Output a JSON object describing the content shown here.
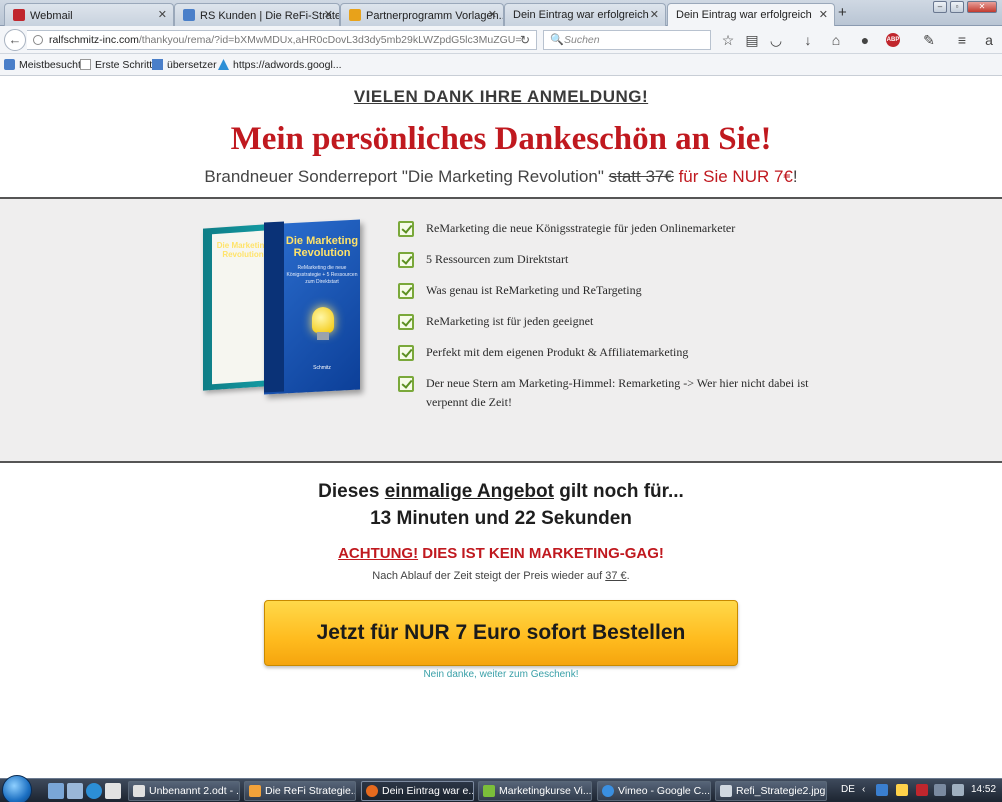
{
  "browser": {
    "tabs": [
      {
        "label": "Webmail",
        "color": "#c0262d"
      },
      {
        "label": "RS Kunden | Die ReFi-Strategie",
        "color": "#4a7fc9"
      },
      {
        "label": "Partnerprogramm Vorlagen...",
        "color": "#e8a21a"
      },
      {
        "label": "Dein Eintrag war erfolgreich",
        "color": "#4a7fc9"
      },
      {
        "label": "Dein Eintrag war erfolgreich",
        "color": "#4a7fc9"
      }
    ],
    "newtab": "+",
    "url_host": "ralfschmitz-inc.com",
    "url_path": "/thankyou/rema/?id=bXMwMDUx,aHR0cDovL3d3dy5mb29kLWZpdG5lc3MuZGU=",
    "search_placeholder": "Suchen",
    "abp_label": "ABP",
    "bookmarks": [
      {
        "label": "Meistbesucht",
        "color": "#4a7fc9"
      },
      {
        "label": "Erste Schritte",
        "color": "#ffffff"
      },
      {
        "label": "übersetzer",
        "color": "#4a7fc9"
      },
      {
        "label": "https://adwords.googl...",
        "color": "#2c8fd6"
      }
    ]
  },
  "page": {
    "vielen_dank": "VIELEN DANK IHRE ANMELDUNG!",
    "title": "Mein persönliches Dankeschön an Sie!",
    "subline_pre": "Brandneuer Sonderreport \"Die Marketing Revolution\"",
    "subline_strike": "statt 37€",
    "subline_red": "für Sie NUR 7€",
    "subline_end": "!",
    "book": {
      "title": "Die Marketing Revolution",
      "subtitle": "ReMarketing die neue Königsstrategie + 5 Ressourcen zum Direktstart",
      "author": "Schmitz",
      "back_title": "Die Marketing Revolution"
    },
    "checklist": [
      "ReMarketing die neue Königsstrategie für jeden Onlinemarketer",
      "5 Ressourcen zum Direktstart",
      "Was genau ist ReMarketing und ReTargeting",
      "ReMarketing ist für jeden geeignet",
      "Perfekt mit dem eigenen Produkt & Affiliatemarketing",
      "Der neue Stern am Marketing-Himmel: Remarketing -> Wer hier nicht dabei ist verpennt die Zeit!"
    ],
    "offer_pre": "Dieses",
    "offer_ul": "einmalige Angebot",
    "offer_post": "gilt noch für...",
    "countdown": "13 Minuten und 22 Sekunden",
    "achtung_ul": "ACHTUNG!",
    "achtung_rest": "DIES IST KEIN MARKETING-GAG!",
    "nach_pre": "Nach Ablauf der Zeit steigt der Preis wieder auf",
    "nach_price": "37 €",
    "nach_post": ".",
    "cta_label": "Jetzt für NUR 7 Euro sofort Bestellen",
    "nein_link": "Nein danke, weiter zum Geschenk!"
  },
  "taskbar": {
    "tasks": [
      {
        "label": "Unbenannt 2.odt - ...",
        "color": "#e0e0e0"
      },
      {
        "label": "Die ReFi Strategie....",
        "color": "#f2a23a"
      },
      {
        "label": "Dein Eintrag war e...",
        "color": "#e66a1e"
      },
      {
        "label": "Marketingkurse Vi...",
        "color": "#7bbf3a"
      },
      {
        "label": "Vimeo - Google C...",
        "color": "#3a8fe0"
      },
      {
        "label": "Refi_Strategie2.jpg...",
        "color": "#d0d8e0"
      }
    ],
    "lang": "DE",
    "clock": "14:52"
  }
}
